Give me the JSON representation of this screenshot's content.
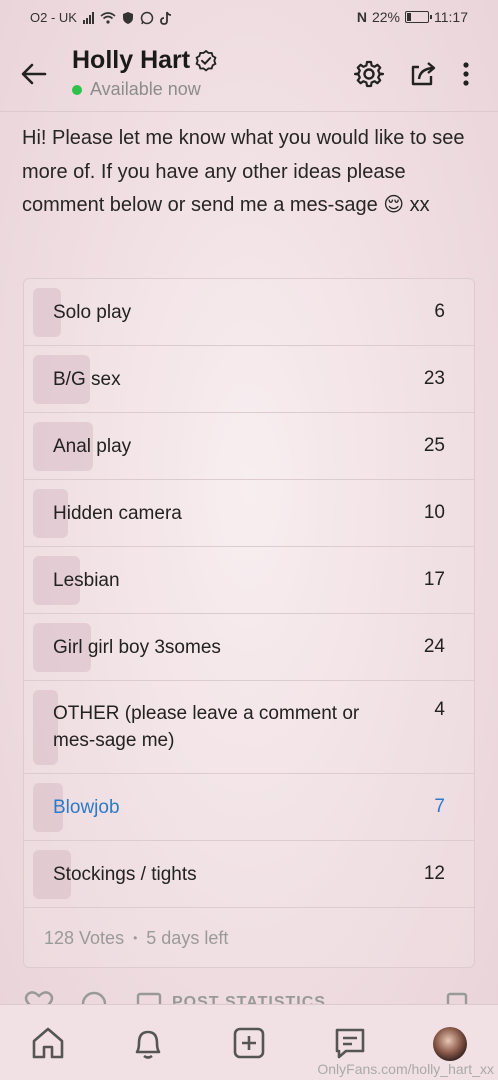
{
  "status_bar": {
    "carrier": "O2 - UK",
    "battery_percent": "22%",
    "battery_level": 0.22,
    "time": "11:17",
    "nfc_label": "N"
  },
  "header": {
    "name": "Holly Hart",
    "status": "Available now",
    "status_color": "#2ec24a"
  },
  "post": {
    "text": "Hi! Please let me know what you would like to see more of. If you have any other ideas please comment below or send me a mes-sage 😌 xx"
  },
  "poll": {
    "options": [
      {
        "label": "Solo play",
        "count": "6",
        "value": 6
      },
      {
        "label": "B/G sex",
        "count": "23",
        "value": 23
      },
      {
        "label": "Anal play",
        "count": "25",
        "value": 25
      },
      {
        "label": "Hidden camera",
        "count": "10",
        "value": 10
      },
      {
        "label": "Lesbian",
        "count": "17",
        "value": 17
      },
      {
        "label": "Girl girl boy 3somes",
        "count": "24",
        "value": 24
      },
      {
        "label": "OTHER (please leave a comment or mes-sage me)",
        "count": "4",
        "value": 4
      },
      {
        "label": "Blowjob",
        "count": "7",
        "value": 7,
        "selected": true
      },
      {
        "label": "Stockings / tights",
        "count": "12",
        "value": 12
      }
    ],
    "votes": "128 Votes",
    "separator": "•",
    "time_left": "5 days left",
    "selected_color": "#2b7bc9"
  },
  "actions": {
    "stats_label": "POST STATISTICS"
  },
  "nav": {
    "items": [
      "home-icon",
      "notifications-icon",
      "add-post-icon",
      "messages-icon",
      "profile-avatar"
    ]
  },
  "watermark": "OnlyFans.com/holly_hart_xx"
}
